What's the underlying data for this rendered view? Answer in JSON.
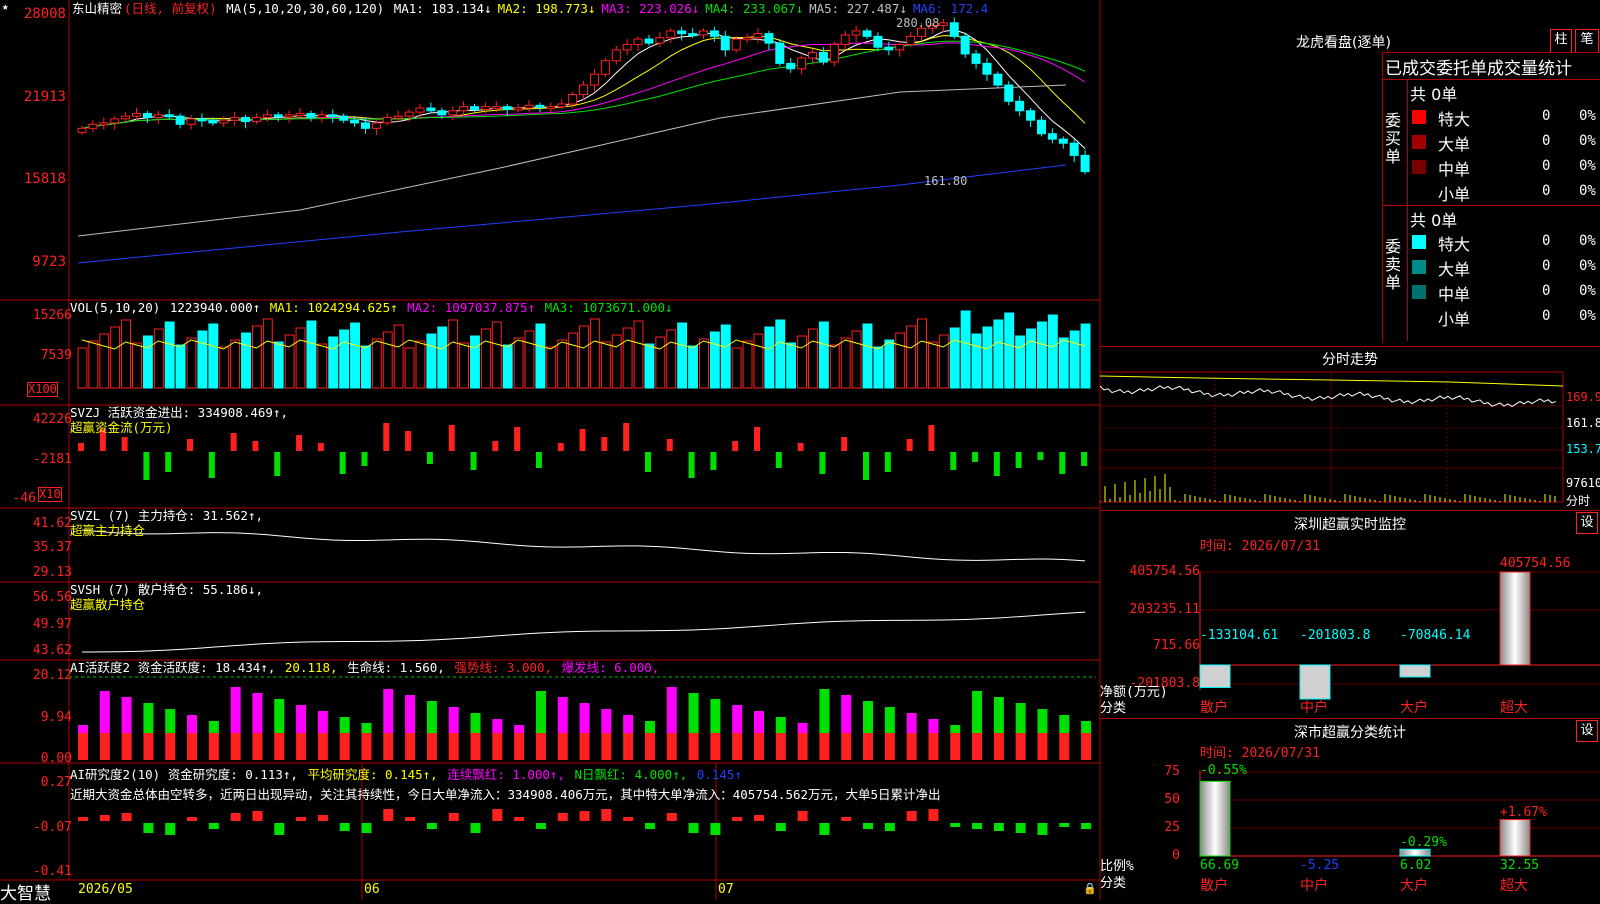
{
  "app": {
    "brand": "大智慧"
  },
  "stock": {
    "name": "东山精密",
    "period": "(日线, 前复权)"
  },
  "main": {
    "ma_params": "MA(5,10,20,30,60,120)",
    "ma": [
      {
        "label": "MA1: 183.134↓",
        "color": "#ffffff"
      },
      {
        "label": "MA2: 198.773↓",
        "color": "#ffff00"
      },
      {
        "label": "MA3: 223.026↓",
        "color": "#ff00ff"
      },
      {
        "label": "MA4: 233.067↓",
        "color": "#00e000"
      },
      {
        "label": "MA5: 227.487↓",
        "color": "#c0c0c0"
      },
      {
        "label": "MA6: 172.4",
        "color": "#2040ff"
      }
    ],
    "yticks": [
      "28008",
      "21913",
      "15818",
      "9723"
    ],
    "high_label": "280.08",
    "low_label": "161.80",
    "candle_closes": [
      200,
      203,
      204,
      207,
      209,
      211,
      208,
      210,
      209,
      203,
      207,
      206,
      204,
      206,
      208,
      205,
      208,
      210,
      209,
      210,
      211,
      208,
      210,
      209,
      206,
      204,
      200,
      204,
      208,
      209,
      212,
      215,
      213,
      210,
      213,
      216,
      214,
      216,
      216,
      214,
      215,
      217,
      216,
      216,
      218,
      225,
      232,
      240,
      250,
      258,
      262,
      266,
      263,
      267,
      272,
      270,
      269,
      272,
      268,
      258,
      266,
      267,
      270,
      263,
      248,
      244,
      252,
      256,
      249,
      262,
      269,
      272,
      268,
      260,
      258,
      262,
      268,
      274,
      276,
      278,
      268,
      255,
      248,
      240,
      232,
      220,
      213,
      206,
      196,
      192,
      189,
      180,
      168
    ]
  },
  "vol": {
    "params": "VOL(5,10,20)",
    "value": "1223940.000↑",
    "ma1": "MA1: 1024294.625↑",
    "ma2": "MA2: 1097037.875↑",
    "ma3": "MA3: 1073671.000↓",
    "yticks": [
      "15266",
      "7539"
    ],
    "unit": "X100"
  },
  "svzj": {
    "title": "SVZJ  活跃资金进出: 334908.469↑,",
    "subtitle": "超赢资金流(万元)",
    "yticks": [
      "42226",
      "-2181",
      "-46"
    ],
    "unit": "X10"
  },
  "svzl": {
    "title": "SVZL (7) 主力持仓: 31.562↑,",
    "subtitle": "超赢主力持仓",
    "yticks": [
      "41.62",
      "35.37",
      "29.13"
    ]
  },
  "svsh": {
    "title": "SVSH (7) 散户持仓: 55.186↓,",
    "subtitle": "超赢散户持仓",
    "yticks": [
      "56.56",
      "49.97",
      "43.62"
    ]
  },
  "ai": {
    "title": "AI活跃度2 资金活跃度: 18.434↑,",
    "v2": "20.118,",
    "life": "生命线: 1.560,",
    "strong": "强势线: 3.000,",
    "burst": "爆发线: 6.000,",
    "yticks": [
      "20.12",
      "9.94",
      "0.00"
    ]
  },
  "ai2": {
    "title": "AI研究度2(10) 资金研究度: 0.113↑,",
    "avg": "平均研究度: 0.145↑,",
    "cont": "连续飘红: 1.000↑,",
    "nday": "N日飘红: 4.000↑,",
    "last": "0.145↑",
    "yticks": [
      "0.27",
      "-0.07",
      "-0.41"
    ],
    "comment": "近期大资金总体由空转多，近两日出现异动，关注其持续性，今日大单净流入：334908.406万元，其中特大单净流入：405754.562万元，大单5日累计净出"
  },
  "xaxis": {
    "labels": [
      "2026/05",
      "06",
      "07"
    ]
  },
  "dragon": {
    "title": "龙虎看盘(逐单)",
    "btn1": "柱",
    "btn2": "笔",
    "header": "已成交委托单成交量统计",
    "buy": {
      "label": "委买单",
      "total": "共 0单",
      "rows": [
        {
          "name": "特大",
          "val": "0",
          "pct": "0%",
          "color": "#ff0000"
        },
        {
          "name": "大单",
          "val": "0",
          "pct": "0%",
          "color": "#a00000"
        },
        {
          "name": "中单",
          "val": "0",
          "pct": "0%",
          "color": "#7a0000"
        },
        {
          "name": "小单",
          "val": "0",
          "pct": "0%",
          "color": "#000000"
        }
      ]
    },
    "sell": {
      "label": "委卖单",
      "total": "共 0单",
      "rows": [
        {
          "name": "特大",
          "val": "0",
          "pct": "0%",
          "color": "#00ffff"
        },
        {
          "name": "大单",
          "val": "0",
          "pct": "0%",
          "color": "#008b8b"
        },
        {
          "name": "中单",
          "val": "0",
          "pct": "0%",
          "color": "#007070"
        },
        {
          "name": "小单",
          "val": "0",
          "pct": "0%",
          "color": "#000000"
        }
      ]
    }
  },
  "intraday": {
    "title": "分时走势",
    "yticks": [
      "169.9",
      "161.8",
      "153.7",
      "97610"
    ],
    "unit": "分时"
  },
  "monitor": {
    "title": "深圳超赢实时监控",
    "btn": "设",
    "time": "时间: 2026/07/31",
    "yticks": [
      "405754.56",
      "203235.11",
      "715.66",
      "-201803.8"
    ],
    "values": [
      {
        "cat": "散户",
        "val": "-133104.61"
      },
      {
        "cat": "中户",
        "val": "-201803.8"
      },
      {
        "cat": "大户",
        "val": "-70846.14"
      },
      {
        "cat": "超大",
        "val": "405754.56"
      }
    ],
    "ylabel1": "净额(万元)",
    "ylabel2": "分类"
  },
  "classify": {
    "title": "深市超赢分类统计",
    "btn": "设",
    "time": "时间: 2026/07/31",
    "yticks": [
      "75",
      "50",
      "25",
      "0"
    ],
    "cats": [
      {
        "cat": "散户",
        "pct": "-0.55%",
        "val": "66.69"
      },
      {
        "cat": "中户",
        "pct": "",
        "val": "-5.25"
      },
      {
        "cat": "大户",
        "pct": "-0.29%",
        "val": "6.02"
      },
      {
        "cat": "超大",
        "pct": "+1.67%",
        "val": "32.55"
      }
    ],
    "ylabel1": "比例%",
    "ylabel2": "分类"
  }
}
